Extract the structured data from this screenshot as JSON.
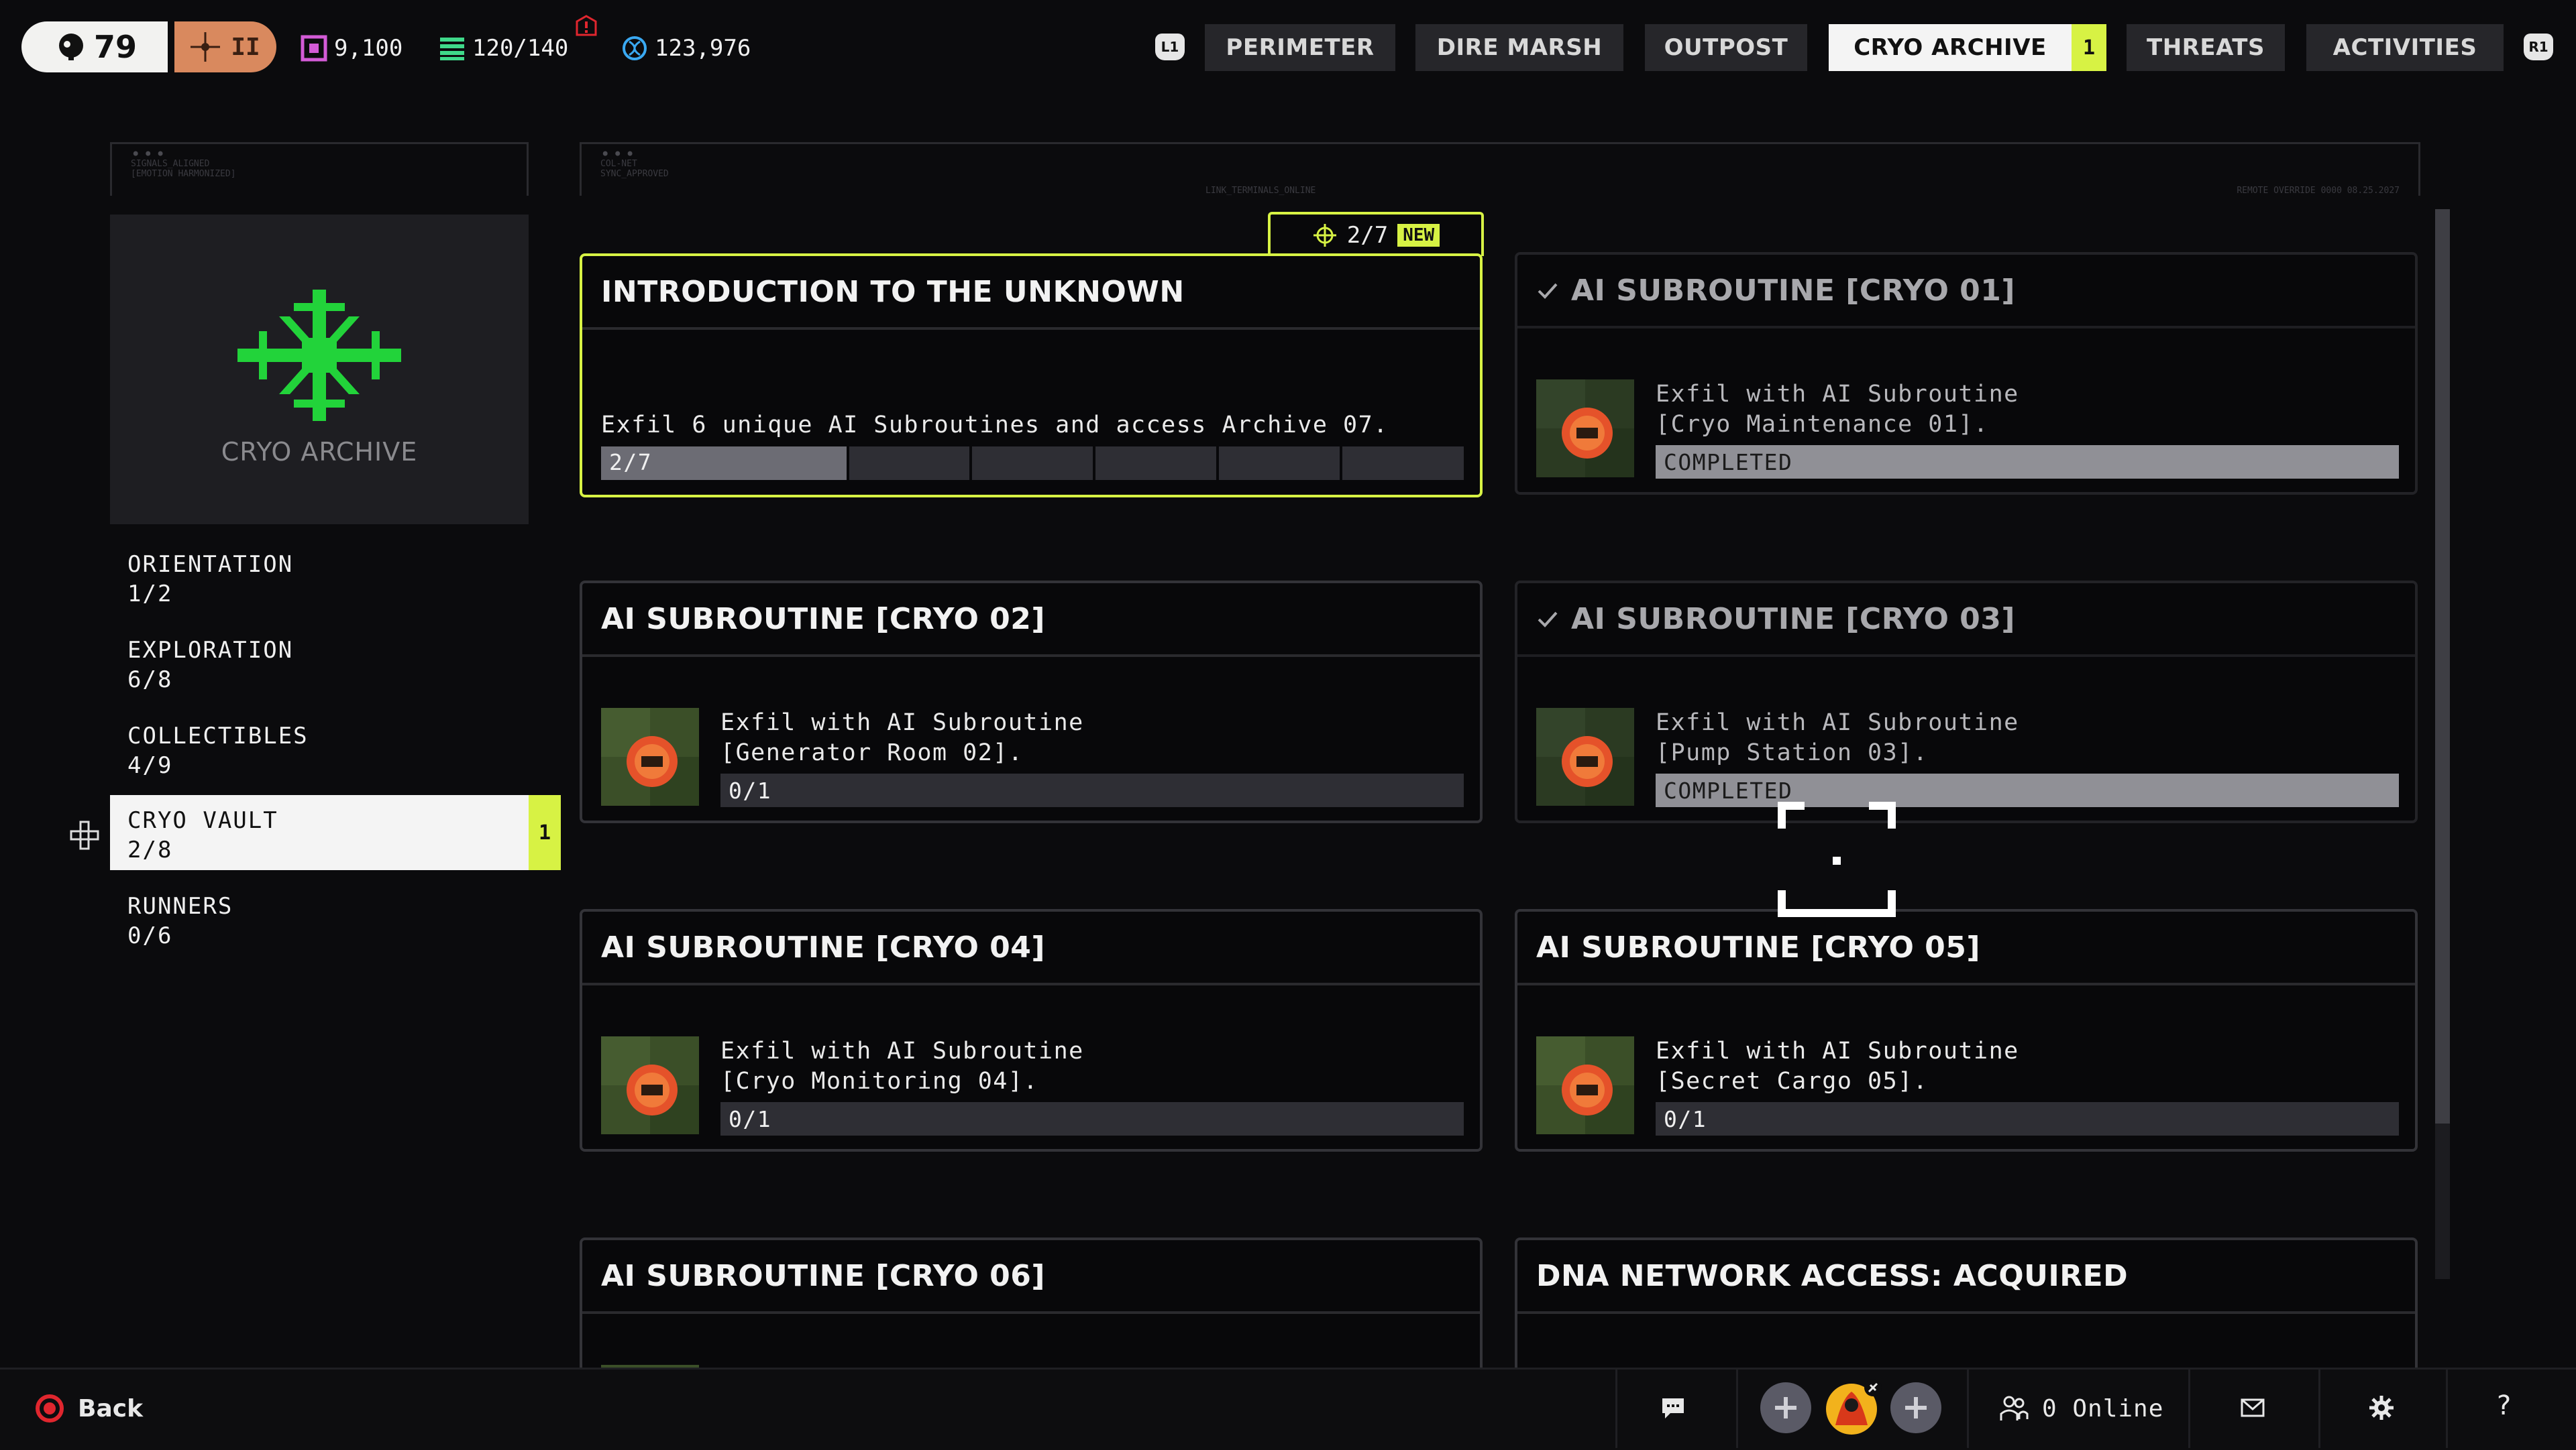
{
  "player": {
    "level": "79",
    "rank": "II"
  },
  "currencies": [
    {
      "icon": "square-coin-icon",
      "value": "9,100",
      "color": "#d35bd6"
    },
    {
      "icon": "stack-icon",
      "value": "120/140",
      "color": "#3fd98a"
    },
    {
      "icon": "dna-icon",
      "value": "123,976",
      "color": "#3aa9f2"
    }
  ],
  "nav": {
    "left_shoulder": "L1",
    "right_shoulder": "R1",
    "tabs": [
      {
        "label": "PERIMETER"
      },
      {
        "label": "DIRE MARSH"
      },
      {
        "label": "OUTPOST"
      },
      {
        "label": "CRYO ARCHIVE",
        "badge": "1"
      },
      {
        "label": "THREATS"
      },
      {
        "label": "ACTIVITIES"
      }
    ]
  },
  "deco": {
    "left_lines": [
      "SIGNALS_ALIGNED",
      "[EMOTION HARMONIZED]"
    ],
    "right_left_lines": [
      "COL-NET",
      "SYNC_APPROVED"
    ],
    "right_center": "LINK_TERMINALS_ONLINE",
    "right_right": "REMOTE OVERRIDE 0000 08.25.2027"
  },
  "category": {
    "label": "CRYO ARCHIVE",
    "icon": "cryo-archive-emblem-icon",
    "color": "#22d33a"
  },
  "sidebar": {
    "items": [
      {
        "name": "ORIENTATION",
        "progress": "1/2"
      },
      {
        "name": "EXPLORATION",
        "progress": "6/8"
      },
      {
        "name": "COLLECTIBLES",
        "progress": "4/9"
      },
      {
        "name": "CRYO VAULT",
        "progress": "2/8",
        "badge": "1"
      },
      {
        "name": "RUNNERS",
        "progress": "0/6"
      }
    ]
  },
  "featured": {
    "tab_progress": "2/7",
    "new_label": "NEW",
    "title": "INTRODUCTION TO THE UNKNOWN",
    "desc": "Exfil 6 unique AI Subroutines and access Archive 07.",
    "progress_label": "2/7",
    "progress_value": 0.2857
  },
  "cards": [
    {
      "title": "AI SUBROUTINE [CRYO 01]",
      "line1": "Exfil with AI Subroutine",
      "line2": "[Cryo Maintenance 01].",
      "status": "COMPLETED"
    },
    {
      "title": "AI SUBROUTINE [CRYO 02]",
      "line1": "Exfil with AI Subroutine",
      "line2": "[Generator Room 02].",
      "status": "0/1"
    },
    {
      "title": "AI SUBROUTINE [CRYO 03]",
      "line1": "Exfil with AI Subroutine",
      "line2": "[Pump Station 03].",
      "status": "COMPLETED"
    },
    {
      "title": "AI SUBROUTINE [CRYO 04]",
      "line1": "Exfil with AI Subroutine",
      "line2": "[Cryo Monitoring 04].",
      "status": "0/1"
    },
    {
      "title": "AI SUBROUTINE [CRYO 05]",
      "line1": "Exfil with AI Subroutine",
      "line2": "[Secret Cargo 05].",
      "status": "0/1"
    },
    {
      "title": "AI SUBROUTINE [CRYO 06]"
    },
    {
      "title": "DNA NETWORK ACCESS: ACQUIRED"
    }
  ],
  "bottom": {
    "back_label": "Back",
    "online_label": "0 Online"
  },
  "colors": {
    "accent": "#d7f244",
    "completed_bar": "#909096"
  }
}
